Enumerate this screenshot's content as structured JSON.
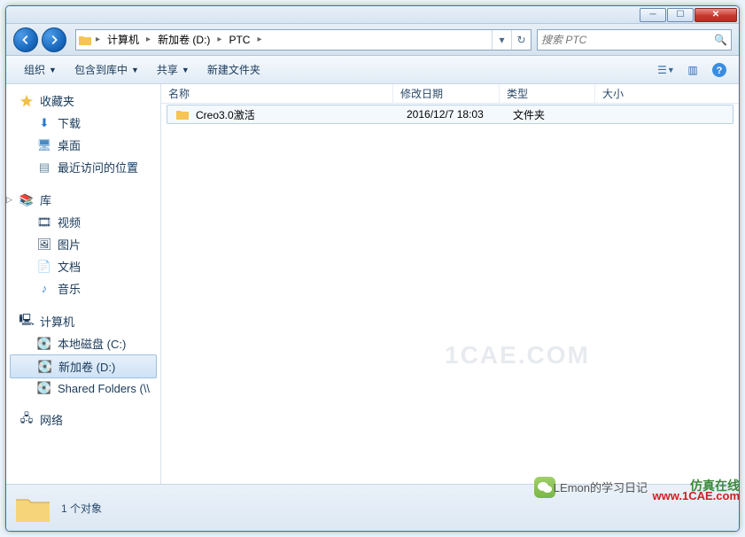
{
  "window": {
    "titlebar": {
      "minimize": "–",
      "maximize": "▭",
      "close": "X"
    },
    "breadcrumb": {
      "seg1": "计算机",
      "seg2": "新加卷 (D:)",
      "seg3": "PTC"
    },
    "search": {
      "placeholder": "搜索 PTC",
      "icon": "search"
    }
  },
  "toolbar": {
    "organize": "组织",
    "include": "包含到库中",
    "share": "共享",
    "newfolder": "新建文件夹"
  },
  "columns": {
    "name": "名称",
    "modified": "修改日期",
    "type": "类型",
    "size": "大小"
  },
  "sidebar": {
    "favorites": {
      "title": "收藏夹",
      "items": [
        "下载",
        "桌面",
        "最近访问的位置"
      ]
    },
    "libraries": {
      "title": "库",
      "items": [
        "视频",
        "图片",
        "文档",
        "音乐"
      ]
    },
    "computer": {
      "title": "计算机",
      "items": [
        "本地磁盘 (C:)",
        "新加卷 (D:)",
        "Shared Folders (\\\\"
      ]
    },
    "network": {
      "title": "网络"
    }
  },
  "files": [
    {
      "name": "Creo3.0激活",
      "modified": "2016/12/7 18:03",
      "type": "文件夹",
      "size": ""
    }
  ],
  "status": {
    "count": "1 个对象"
  },
  "watermarks": {
    "center": "1CAE.COM",
    "green": "仿真在线",
    "red": "www.1CAE.com",
    "gray": "LEmon的学习日记"
  }
}
